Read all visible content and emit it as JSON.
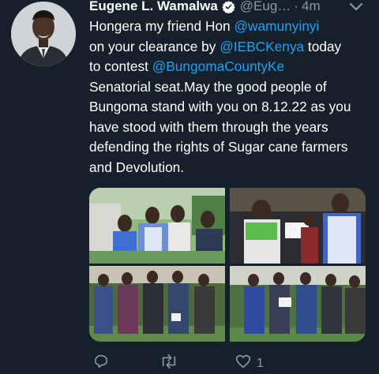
{
  "tweet": {
    "author_name": "Eugene L. Wamalwa",
    "handle": "@Eug…",
    "separator": "·",
    "time": "4m",
    "text": {
      "line1_pre": "Hongera my friend Hon ",
      "mention1": "@wamunyinyi",
      "line2_pre": "on your clearance by ",
      "mention2": "@IEBCKenya",
      "line2_post": " today",
      "line3_pre": "to contest ",
      "mention3": "@BungomaCountyKe",
      "body": "Senatorial seat.May the good people of Bungoma stand with you on 8.12.22 as you have stood with them through the years defending the rights of Sugar cane farmers and Devolution."
    },
    "actions": {
      "like_count": "1"
    }
  },
  "icons": {
    "verified": "verified-badge-icon",
    "chevron": "chevron-down-icon",
    "reply": "reply-icon",
    "retweet": "retweet-icon",
    "like": "like-icon"
  },
  "colors": {
    "background": "#15202b",
    "link": "#1da1f2",
    "muted": "#8899a6"
  }
}
